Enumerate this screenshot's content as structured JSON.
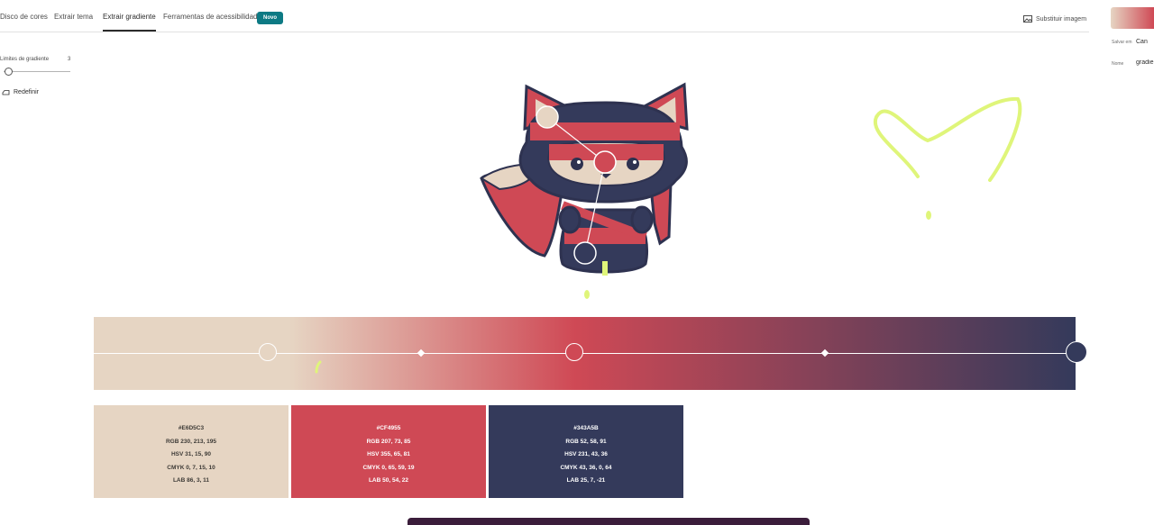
{
  "tabs": [
    {
      "label": "Disco de cores"
    },
    {
      "label": "Extrair tema"
    },
    {
      "label": "Extrair gradiente"
    },
    {
      "label": "Ferramentas de acessibilidade"
    }
  ],
  "new_badge": "Novo",
  "replace_image_label": "Substituir imagem",
  "left_panel": {
    "gradient_stops_label": "Limites de gradiente",
    "gradient_stops_count": "3",
    "reset_label": "Redefinir"
  },
  "right_panel": {
    "save_in_label": "Salvar em",
    "save_in_value": "Can",
    "name_label": "Nome",
    "name_value": "gradie"
  },
  "colors": [
    {
      "hex": "#E6D5C3",
      "rgb": "RGB 230, 213, 195",
      "hsv": "HSV 31, 15, 90",
      "cmyk": "CMYK 0, 7, 15, 10",
      "lab": "LAB 86, 3, 11"
    },
    {
      "hex": "#CF4955",
      "rgb": "RGB 207, 73, 85",
      "hsv": "HSV 355, 65, 81",
      "cmyk": "CMYK 0, 65, 59, 19",
      "lab": "LAB 50, 54, 22"
    },
    {
      "hex": "#343A5B",
      "rgb": "RGB 52, 58, 91",
      "hsv": "HSV 231, 43, 36",
      "cmyk": "CMYK 43, 36, 0, 64",
      "lab": "LAB 25, 7, -21"
    }
  ],
  "accent_colors": {
    "active_tab_underline": "#2c2c2c",
    "new_badge_bg": "#0d7a84",
    "scribble": "#dff57a"
  }
}
